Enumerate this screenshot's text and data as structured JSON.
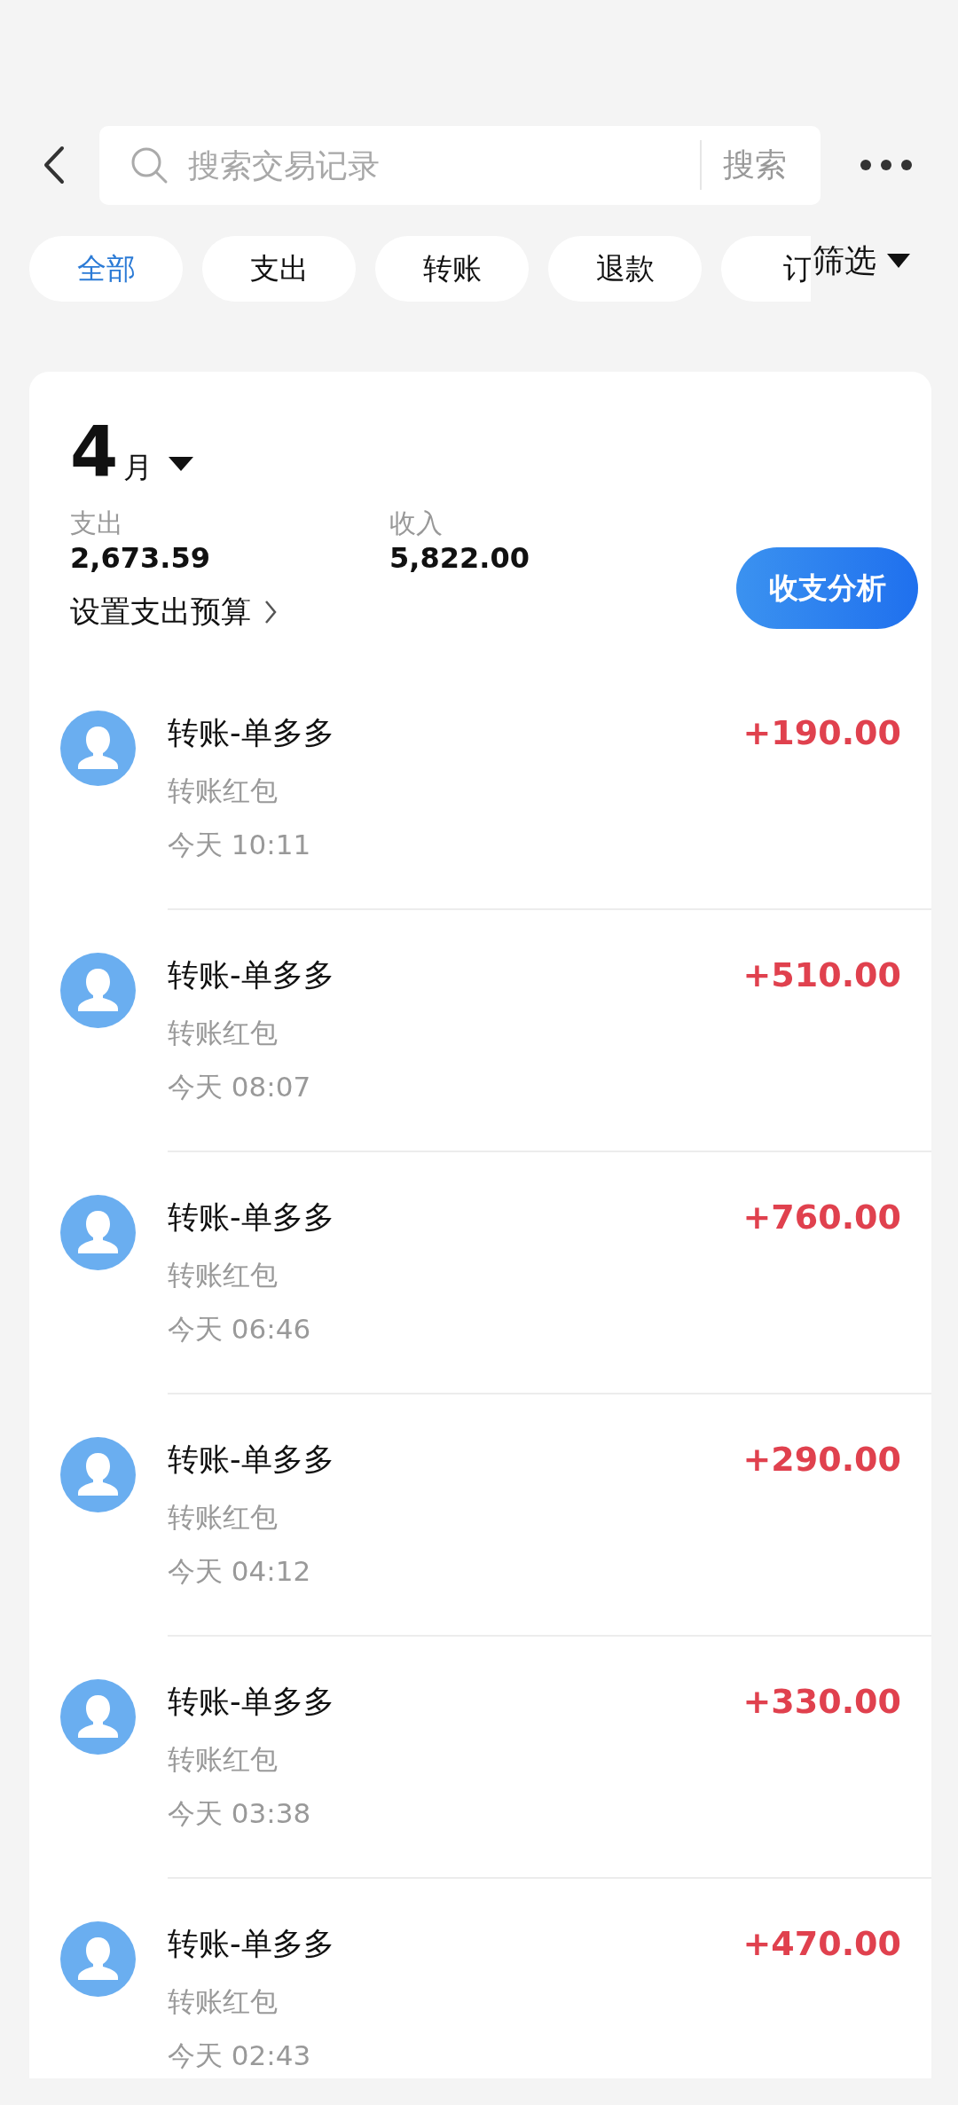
{
  "search": {
    "placeholder": "搜索交易记录",
    "button": "搜索"
  },
  "tabs": [
    {
      "label": "全部",
      "selected": true
    },
    {
      "label": "支出",
      "selected": false
    },
    {
      "label": "转账",
      "selected": false
    },
    {
      "label": "退款",
      "selected": false
    },
    {
      "label": "订",
      "selected": false
    }
  ],
  "filter": "筛选",
  "summary": {
    "month": "4",
    "month_unit": "月",
    "expense_label": "支出",
    "expense": "2,673.59",
    "income_label": "收入",
    "income": "5,822.00",
    "budget_link": "设置支出预算",
    "analysis_button": "收支分析"
  },
  "transactions": [
    {
      "title": "转账-单多多",
      "note": "转账红包",
      "time": "今天 10:11",
      "amount": "+190.00"
    },
    {
      "title": "转账-单多多",
      "note": "转账红包",
      "time": "今天 08:07",
      "amount": "+510.00"
    },
    {
      "title": "转账-单多多",
      "note": "转账红包",
      "time": "今天 06:46",
      "amount": "+760.00"
    },
    {
      "title": "转账-单多多",
      "note": "转账红包",
      "time": "今天 04:12",
      "amount": "+290.00"
    },
    {
      "title": "转账-单多多",
      "note": "转账红包",
      "time": "今天 03:38",
      "amount": "+330.00"
    },
    {
      "title": "转账-单多多",
      "note": "转账红包",
      "time": "今天 02:43",
      "amount": "+470.00"
    }
  ]
}
